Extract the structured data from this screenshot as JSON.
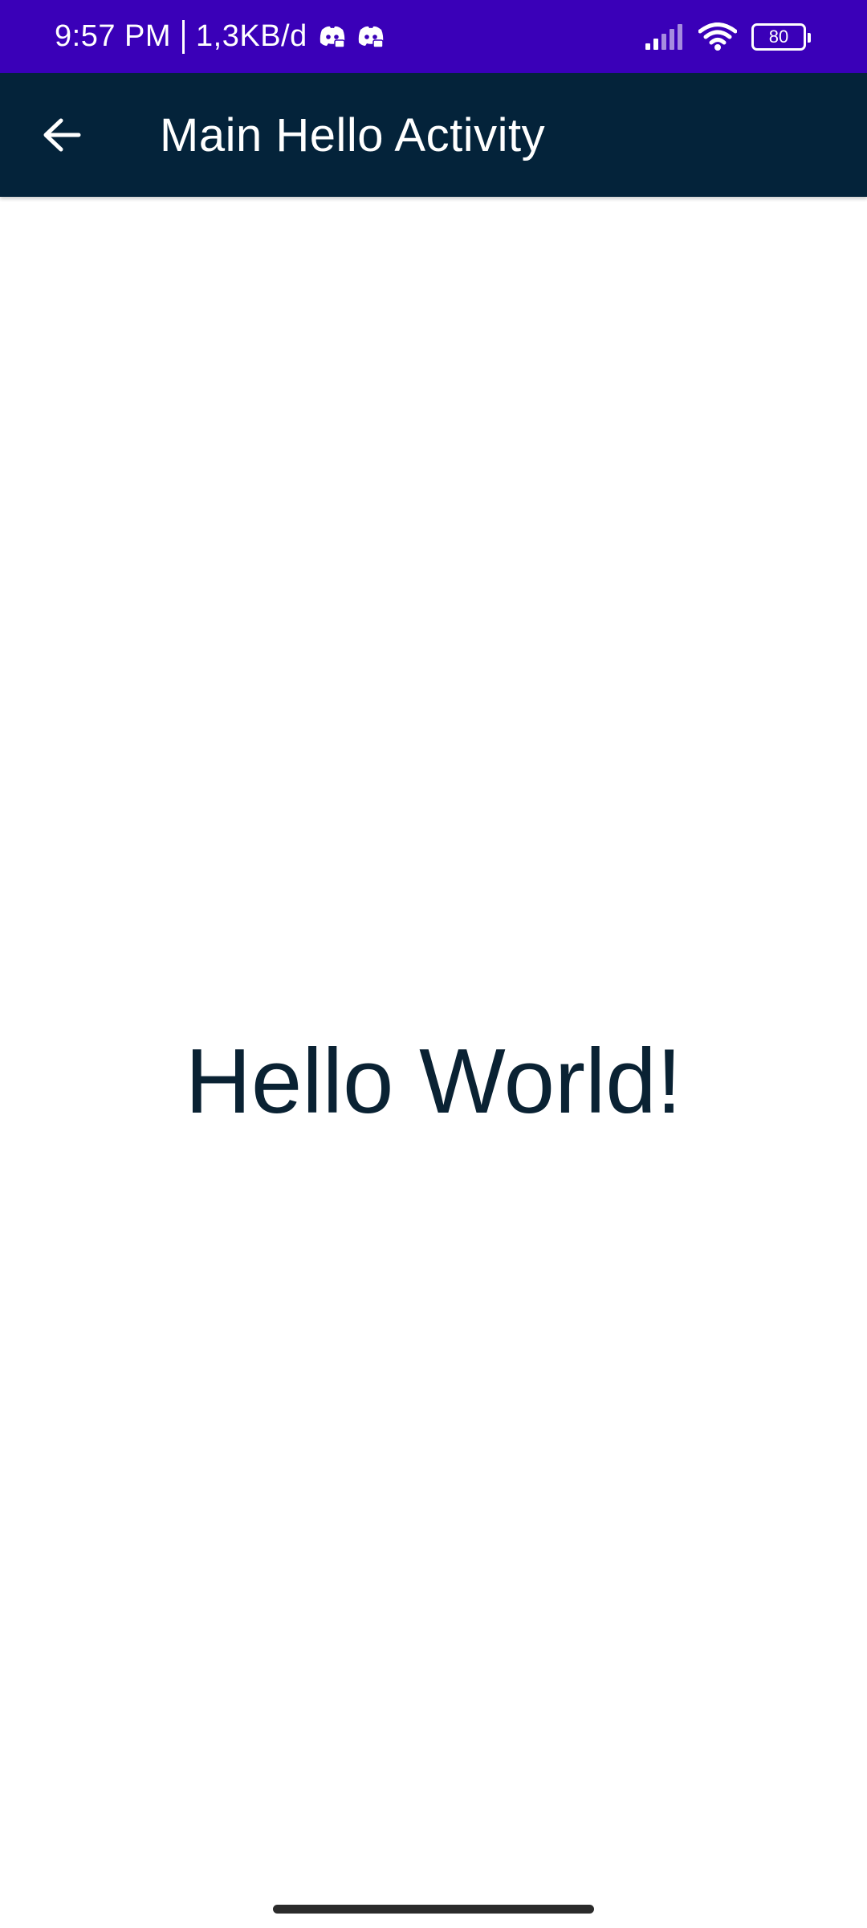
{
  "status_bar": {
    "time": "9:57 PM",
    "data_rate": "1,3KB/d",
    "battery_level": "80",
    "notification_icons": [
      "discord-icon",
      "discord-icon"
    ],
    "background_color": "#3a00b8"
  },
  "app_bar": {
    "title": "Main Hello Activity",
    "back_icon": "arrow-back-icon",
    "background_color": "#04233a"
  },
  "main": {
    "hello_text": "Hello World!",
    "text_color": "#0a2233"
  }
}
